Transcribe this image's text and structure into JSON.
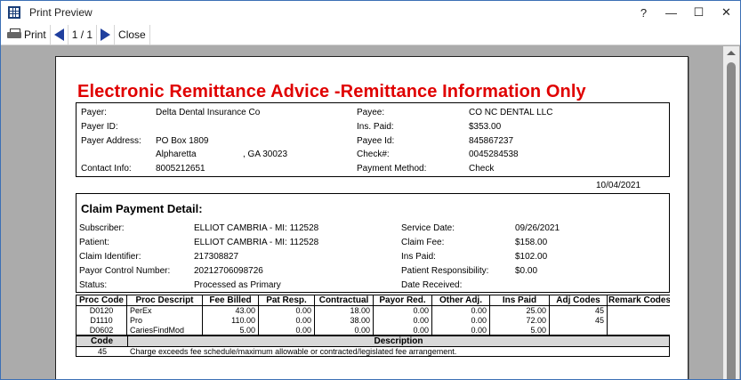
{
  "window": {
    "title": "Print Preview",
    "help": "?",
    "minimize": "—",
    "maximize": "☐",
    "close": "✕"
  },
  "toolbar": {
    "print_label": "Print",
    "page_indicator": "1 / 1",
    "close_label": "Close"
  },
  "report": {
    "title": "Electronic Remittance Advice -Remittance Information Only",
    "date": "10/04/2021",
    "payer": {
      "payer_label": "Payer:",
      "payer_value": "Delta Dental Insurance Co",
      "payer_id_label": "Payer ID:",
      "payer_id_value": "",
      "address_label": "Payer Address:",
      "address_line1": "PO Box 1809",
      "address_city": "Alpharetta",
      "address_state_zip": ", GA  30023",
      "contact_label": "Contact Info:",
      "contact_value": "8005212651",
      "payee_label": "Payee:",
      "payee_value": "CO NC DENTAL LLC",
      "ins_paid_label": "Ins. Paid:",
      "ins_paid_value": "$353.00",
      "payee_id_label": "Payee Id:",
      "payee_id_value": "845867237",
      "check_label": "Check#:",
      "check_value": "0045284538",
      "method_label": "Payment Method:",
      "method_value": "Check"
    },
    "claim": {
      "section_title": "Claim Payment Detail:",
      "subscriber_label": "Subscriber:",
      "subscriber_value": "ELLIOT CAMBRIA - MI: 112528",
      "patient_label": "Patient:",
      "patient_value": "ELLIOT CAMBRIA - MI: 112528",
      "claim_id_label": "Claim Identifier:",
      "claim_id_value": "217308827",
      "payor_ctrl_label": "Payor Control Number:",
      "payor_ctrl_value": "20212706098726",
      "status_label": "Status:",
      "status_value": "Processed as Primary",
      "service_date_label": "Service Date:",
      "service_date_value": "09/26/2021",
      "claim_fee_label": "Claim Fee:",
      "claim_fee_value": "$158.00",
      "ins_paid_label": "Ins Paid:",
      "ins_paid_value": "$102.00",
      "pat_resp_label": "Patient Responsibility:",
      "pat_resp_value": "$0.00",
      "date_received_label": "Date Received:",
      "date_received_value": ""
    },
    "procedures": {
      "headers": [
        "Proc Code",
        "Proc Descript",
        "Fee Billed",
        "Pat Resp.",
        "Contractual",
        "Payor Red.",
        "Other Adj.",
        "Ins Paid",
        "Adj Codes",
        "Remark Codes"
      ],
      "rows": [
        [
          "D0120",
          "PerEx",
          "43.00",
          "0.00",
          "18.00",
          "0.00",
          "0.00",
          "25.00",
          "45",
          ""
        ],
        [
          "D1110",
          "Pro",
          "110.00",
          "0.00",
          "38.00",
          "0.00",
          "0.00",
          "72.00",
          "45",
          ""
        ],
        [
          "D0602",
          "CariesFindMod",
          "5.00",
          "0.00",
          "0.00",
          "0.00",
          "0.00",
          "5.00",
          "",
          ""
        ]
      ]
    },
    "codes": {
      "code_header": "Code",
      "desc_header": "Description",
      "rows": [
        {
          "code": "45",
          "description": "Charge exceeds fee schedule/maximum allowable or contracted/legislated fee arrangement."
        }
      ]
    }
  }
}
